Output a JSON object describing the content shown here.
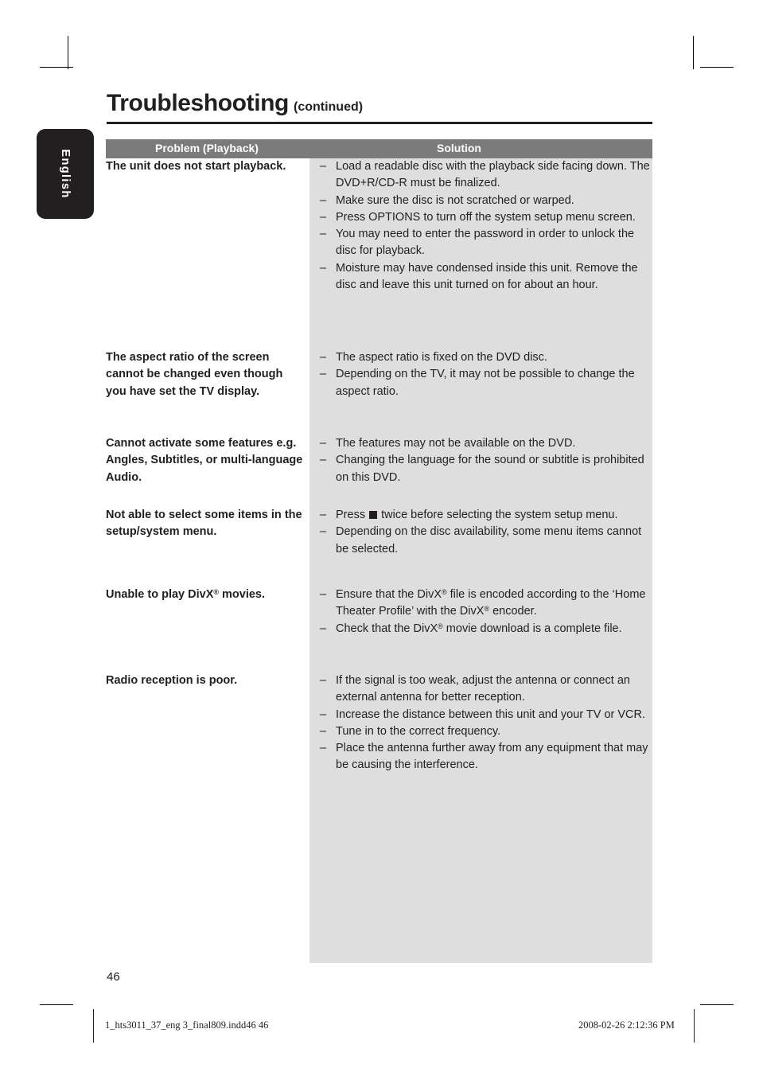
{
  "page": {
    "title_main": "Troubleshooting",
    "title_sub": "(continued)",
    "page_number": "46",
    "language_tab": "English"
  },
  "table": {
    "header": {
      "problem": "Problem (Playback)",
      "solution": "Solution"
    },
    "rows": [
      {
        "problem": "The unit does not start playback.",
        "solutions": [
          "Load a readable disc with the playback side facing down. The DVD+R/CD-R must be finalized.",
          "Make sure the disc is not scratched or warped.",
          "Press OPTIONS to turn off the system setup menu screen.",
          "You may need to enter the password in order to unlock the disc for playback.",
          "Moisture may have condensed inside this unit. Remove the disc and leave this unit turned on for about an hour."
        ]
      },
      {
        "problem": "The aspect ratio of the screen cannot be changed even though you have set the TV display.",
        "solutions": [
          "The aspect ratio is fixed on the DVD disc.",
          "Depending on the TV, it may not be possible to change the aspect ratio."
        ]
      },
      {
        "problem": "Cannot activate some features e.g. Angles, Subtitles, or multi-language Audio.",
        "solutions": [
          "The features may not be available on the DVD.",
          "Changing the language for the sound or subtitle is prohibited on this DVD."
        ]
      },
      {
        "problem": "Not able to select some items in the setup/system menu.",
        "solutions": [
          "Press ■ twice before selecting the system setup menu.",
          "Depending on the disc availability, some menu items cannot be selected."
        ]
      },
      {
        "problem": "Unable to play DivX® movies.",
        "solutions": [
          "Ensure that the DivX® file is encoded according to the ‘Home Theater Profile’ with the DivX® encoder.",
          "Check that the DivX® movie download is a complete file."
        ]
      },
      {
        "problem": "Radio reception is poor.",
        "solutions": [
          "If the signal is too weak, adjust the antenna or connect an external antenna for better reception.",
          "Increase the distance between this unit and your TV or VCR.",
          "Tune in to the correct frequency.",
          "Place the antenna further away from any equipment that may be causing the interference."
        ]
      }
    ]
  },
  "footer": {
    "file_name": "1_hts3011_37_eng 3_final809.indd46   46",
    "timestamp": "2008-02-26   2:12:36 PM"
  },
  "colors": {
    "header_bar": "#7b7b7b",
    "solution_panel": "#dedede",
    "tab_background": "#231f20",
    "text": "#221f1f"
  },
  "row_offsets": [
    0,
    240,
    348,
    438,
    538,
    646
  ],
  "bullet_dash": "–"
}
